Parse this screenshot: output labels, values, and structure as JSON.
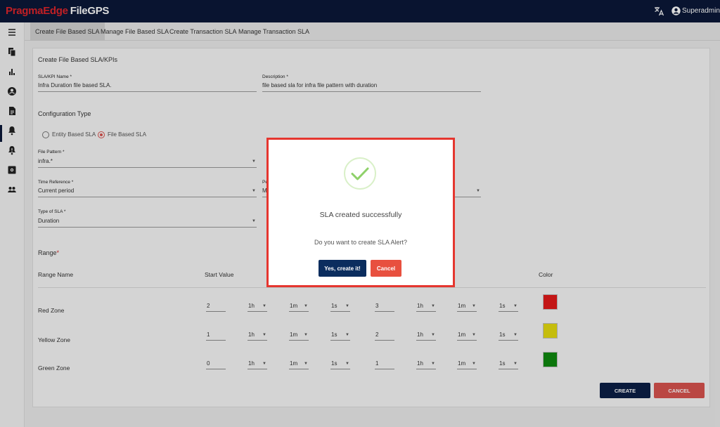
{
  "app": {
    "brand_primary": "PragmaEdge",
    "brand_secondary": "FileGPS",
    "user": "Superadmin"
  },
  "colors": {
    "topbar": "#0b1838",
    "brand_red": "#e0252b",
    "primary": "#0b1f46",
    "danger": "#d9534f",
    "red_zone": "#e41a1a",
    "yellow_zone": "#e6dc10",
    "green_zone": "#0f8a0f",
    "dialog_border": "#e5362f"
  },
  "sidebar": {
    "icons": [
      "menu-icon",
      "file-copy-icon",
      "bar-chart-icon",
      "account-circle-icon",
      "description-icon",
      "bell-icon",
      "alert-bell-icon",
      "settings-box-icon",
      "group-icon"
    ],
    "active_index": 4
  },
  "tabs": [
    {
      "label": "Create File Based SLA",
      "active": true
    },
    {
      "label": "Manage File Based SLA",
      "active": false
    },
    {
      "label": "Create Transaction SLA",
      "active": false
    },
    {
      "label": "Manage Transaction SLA",
      "active": false
    }
  ],
  "form": {
    "title": "Create File Based SLA/KPIs",
    "sla_name": {
      "label": "SLA/KPI Name *",
      "value": "Infra Duration file based SLA."
    },
    "description": {
      "label": "Description *",
      "value": "file based sla for infra file pattern with duration"
    },
    "config_type": {
      "title": "Configuration Type",
      "options": [
        {
          "label": "Entity Based SLA",
          "checked": false
        },
        {
          "label": "File Based SLA",
          "checked": true
        }
      ]
    },
    "file_pattern": {
      "label": "File Pattern *",
      "value": "infra.*"
    },
    "time_reference": {
      "label": "Time Reference *",
      "value": "Current period"
    },
    "period_partial": {
      "label": "Pe",
      "value": "M"
    },
    "type_of_sla": {
      "label": "Type of SLA *",
      "value": "Duration"
    },
    "range": {
      "title": "Range",
      "required_mark": "*",
      "headers": {
        "name": "Range Name",
        "start": "Start Value",
        "color": "Color"
      },
      "rows": [
        {
          "name": "Red Zone",
          "start": "2",
          "s_h": "1h",
          "s_m": "1m",
          "s_s": "1s",
          "end": "3",
          "e_h": "1h",
          "e_m": "1m",
          "e_s": "1s"
        },
        {
          "name": "Yellow Zone",
          "start": "1",
          "s_h": "1h",
          "s_m": "1m",
          "s_s": "1s",
          "end": "2",
          "e_h": "1h",
          "e_m": "1m",
          "e_s": "1s"
        },
        {
          "name": "Green Zone",
          "start": "0",
          "s_h": "1h",
          "s_m": "1m",
          "s_s": "1s",
          "end": "1",
          "e_h": "1h",
          "e_m": "1m",
          "e_s": "1s"
        }
      ]
    },
    "create_label": "CREATE",
    "cancel_label": "CANCEL"
  },
  "dialog": {
    "title": "SLA created successfully",
    "message": "Do you want to create SLA Alert?",
    "confirm_label": "Yes, create it!",
    "cancel_label": "Cancel"
  }
}
